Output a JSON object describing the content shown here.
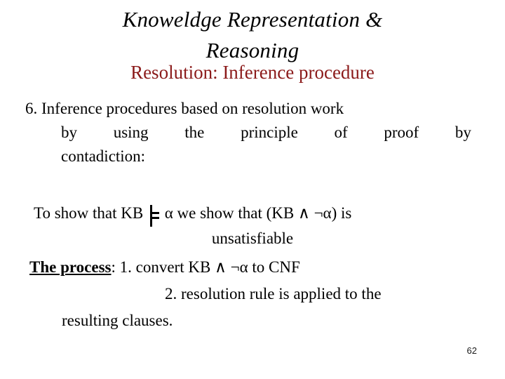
{
  "slide": {
    "title_lines": [
      "Knoweldge Representation &",
      "Reasoning"
    ],
    "subtitle": "Resolution: Inference procedure",
    "paragraph_one": {
      "line1": "6. Inference procedures based on resolution work",
      "line2_words": [
        "by",
        "using",
        "the",
        "principle",
        "of",
        "proof",
        "by"
      ],
      "line3": "contadiction:"
    },
    "paragraph_two": {
      "prefix": "To show that KB ",
      "entail_symbol": "⊨",
      "suffix": " α we show that (KB ∧ ¬α) is",
      "line2": "unsatisfiable"
    },
    "paragraph_three": {
      "label": "The process",
      "step1": ": 1. convert KB ∧ ¬α to CNF",
      "step2": "2. resolution rule is applied to the",
      "step2_cont": "resulting clauses."
    },
    "slide_number": "62",
    "colors": {
      "title": "#000000",
      "subtitle": "#8B1A1A",
      "body": "#000000",
      "background": "#ffffff",
      "slide_number": "#1a1a1a"
    }
  }
}
